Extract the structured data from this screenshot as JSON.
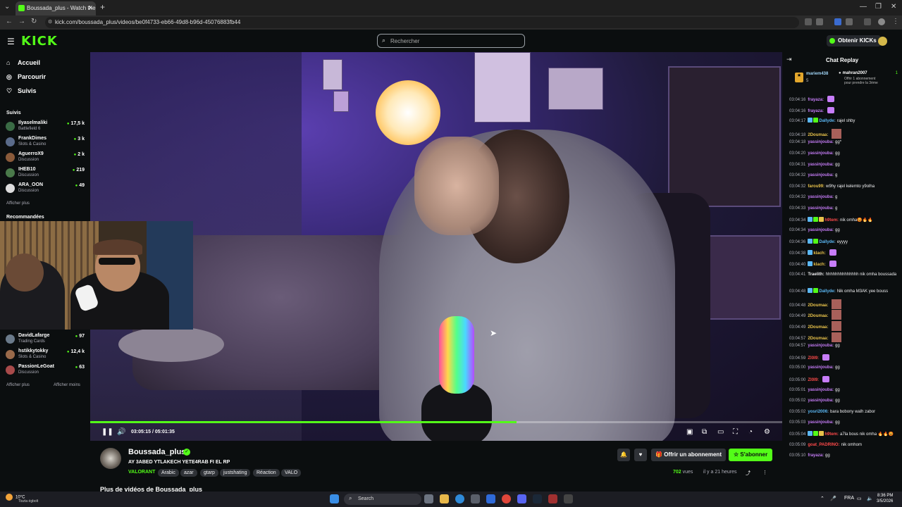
{
  "browser": {
    "tab_title": "Boussada_plus - Watch the",
    "url": "kick.com/boussada_plus/videos/be0f4733-eb66-49d8-b96d-45076883fb44"
  },
  "header": {
    "logo": "KICK",
    "search_placeholder": "Rechercher",
    "get_kicks": "Obtenir KICKs"
  },
  "sidebar": {
    "nav": [
      {
        "label": "Accueil",
        "icon": "home-icon"
      },
      {
        "label": "Parcourir",
        "icon": "compass-icon"
      },
      {
        "label": "Suivis",
        "icon": "heart-icon"
      }
    ],
    "following_title": "Suivis",
    "following": [
      {
        "name": "Ilyaselmaliki",
        "category": "Battlefield 6",
        "viewers": "17,5 k",
        "color": "#3a6b45"
      },
      {
        "name": "FrankDimes",
        "category": "Slots & Casino",
        "viewers": "3 k",
        "color": "#5a6b8a"
      },
      {
        "name": "AguerroX9",
        "category": "Discussion",
        "viewers": "2 k",
        "color": "#8a5a3a"
      },
      {
        "name": "IHEB10",
        "category": "Discussion",
        "viewers": "219",
        "color": "#4a7a4a"
      },
      {
        "name": "ARA_OON",
        "category": "Discussion",
        "viewers": "49",
        "color": "#dddddd"
      }
    ],
    "show_more": "Afficher plus",
    "recommended_title": "Recommandées",
    "recommended": [
      {
        "name": "DavidLafarge",
        "category": "Trading Cards",
        "viewers": "97",
        "color": "#6a7a8a"
      },
      {
        "name": "hstikkytokky",
        "category": "Slots & Casino",
        "viewers": "12,4 k",
        "color": "#9a6a4a"
      },
      {
        "name": "PassionLeGoat",
        "category": "Discussion",
        "viewers": "63",
        "color": "#a84a4a"
      }
    ],
    "show_more_2": "Afficher plus",
    "show_less": "Afficher moins"
  },
  "player": {
    "current_time": "03:05:15",
    "duration": "05:01:35",
    "progress_fraction": 0.616
  },
  "stream_info": {
    "channel": "Boussada_plus",
    "title": "AY 3ABED YTLAKECH YETE4RAB FI EL RP",
    "category": "VALORANT",
    "tags": [
      "Arabic",
      "azar",
      "gtarp",
      "justshating",
      "Réaction",
      "VALO"
    ],
    "subscribe_gift": "Offrir un abonnement",
    "subscribe": "S'abonner",
    "views": "702",
    "views_label": "vues",
    "age": "il y a 21 heures",
    "more_videos": "Plus de vidéos de Boussada_plus"
  },
  "chat": {
    "title": "Chat Replay",
    "pinned": {
      "user1": "mariem438",
      "user1_sub": "5",
      "user2": "mahran2007",
      "user2_count": "1",
      "line1": "Offrir 1 abonnement",
      "line2": "pour prendre la 3ème"
    },
    "messages": [
      {
        "ts": "03:04:16",
        "user": "frayaza:",
        "text": "",
        "color": "#c47bf5",
        "emote": "purple"
      },
      {
        "ts": "03:04:16",
        "user": "frayaza:",
        "text": "",
        "color": "#c47bf5",
        "emote": "purple"
      },
      {
        "ts": "03:04:17",
        "user": "Dallyde:",
        "text": "rajel shby",
        "color": "#5bb8f5",
        "badges": 2
      },
      {
        "ts": "03:04:18",
        "user": "2Doumaa:",
        "text": "",
        "color": "#e8c24a",
        "emote": "square"
      },
      {
        "ts": "03:04:18",
        "user": "yassinjouba:",
        "text": "gg*",
        "color": "#c47bf5"
      },
      {
        "ts": "03:04:20",
        "user": "yassinjouba:",
        "text": "gg",
        "color": "#c47bf5"
      },
      {
        "ts": "03:04:31",
        "user": "yassinjouba:",
        "text": "gg",
        "color": "#c47bf5"
      },
      {
        "ts": "03:04:32",
        "user": "yassinjouba:",
        "text": "g",
        "color": "#c47bf5"
      },
      {
        "ts": "03:04:32",
        "user": "farou99:",
        "text": "w9hy rajel kelemto y9olha",
        "color": "#e8c24a"
      },
      {
        "ts": "03:04:32",
        "user": "yassinjouba:",
        "text": "g",
        "color": "#c47bf5"
      },
      {
        "ts": "03:04:33",
        "user": "yassinjouba:",
        "text": "g",
        "color": "#c47bf5"
      },
      {
        "ts": "03:04:34",
        "user": "h9tem:",
        "text": "nik omha😡🔥🔥",
        "color": "#ff4a4a",
        "badges": 3
      },
      {
        "ts": "03:04:34",
        "user": "yassinjouba:",
        "text": "gg",
        "color": "#c47bf5"
      },
      {
        "ts": "03:04:36",
        "user": "Dallyde:",
        "text": "eyyyy",
        "color": "#5bb8f5",
        "badges": 2
      },
      {
        "ts": "03:04:38",
        "user": "klach:",
        "text": "",
        "color": "#e8c24a",
        "badges": 1,
        "emote": "purple"
      },
      {
        "ts": "03:04:40",
        "user": "klach:",
        "text": "",
        "color": "#e8c24a",
        "badges": 1,
        "emote": "purple"
      },
      {
        "ts": "03:04:41",
        "user": "Traelith:",
        "text": "hhhhhhhhhhhhhh nik omha boussada",
        "color": "#efeff1"
      },
      {
        "ts": "03:04:48",
        "user": "Dallyde:",
        "text": "Nik omha M3AK yee bouss",
        "color": "#5bb8f5",
        "badges": 2
      },
      {
        "ts": "03:04:48",
        "user": "2Doumaa:",
        "text": "",
        "color": "#e8c24a",
        "emote": "square"
      },
      {
        "ts": "03:04:49",
        "user": "2Doumaa:",
        "text": "",
        "color": "#e8c24a",
        "emote": "square"
      },
      {
        "ts": "03:04:49",
        "user": "2Doumaa:",
        "text": "",
        "color": "#e8c24a",
        "emote": "square"
      },
      {
        "ts": "03:04:57",
        "user": "2Doumaa:",
        "text": "",
        "color": "#e8c24a",
        "emote": "square"
      },
      {
        "ts": "03:04:57",
        "user": "yassinjouba:",
        "text": "gg",
        "color": "#c47bf5"
      },
      {
        "ts": "03:04:59",
        "user": "ZI0I9:",
        "text": "",
        "color": "#ff4a4a",
        "emote": "purple"
      },
      {
        "ts": "03:05:00",
        "user": "yassinjouba:",
        "text": "gg",
        "color": "#c47bf5"
      },
      {
        "ts": "03:05:00",
        "user": "ZI0I9:",
        "text": "",
        "color": "#ff4a4a",
        "emote": "purple"
      },
      {
        "ts": "03:05:01",
        "user": "yassinjouba:",
        "text": "gg",
        "color": "#c47bf5"
      },
      {
        "ts": "03:05:02",
        "user": "yassinjouba:",
        "text": "gg",
        "color": "#c47bf5"
      },
      {
        "ts": "03:05:02",
        "user": "yosri2006:",
        "text": "bara bobony walh zabor",
        "color": "#5bb8f5"
      },
      {
        "ts": "03:05:03",
        "user": "yassinjouba:",
        "text": "gg",
        "color": "#c47bf5"
      },
      {
        "ts": "03:05:04",
        "user": "h9tem:",
        "text": "a7la bous nik omha 🔥🔥😡",
        "color": "#ff4a4a",
        "badges": 3
      },
      {
        "ts": "03:05:09",
        "user": "goat_PADRINO:",
        "text": "nik omhom",
        "color": "#ff4a4a"
      },
      {
        "ts": "03:05:10",
        "user": "frayaza:",
        "text": "gg",
        "color": "#c47bf5"
      }
    ]
  },
  "taskbar": {
    "temp": "10°C",
    "weather": "Tiszta égbolt",
    "search": "Search",
    "lang": "FRA",
    "time": "8:36 PM",
    "date": "3/5/2026"
  }
}
